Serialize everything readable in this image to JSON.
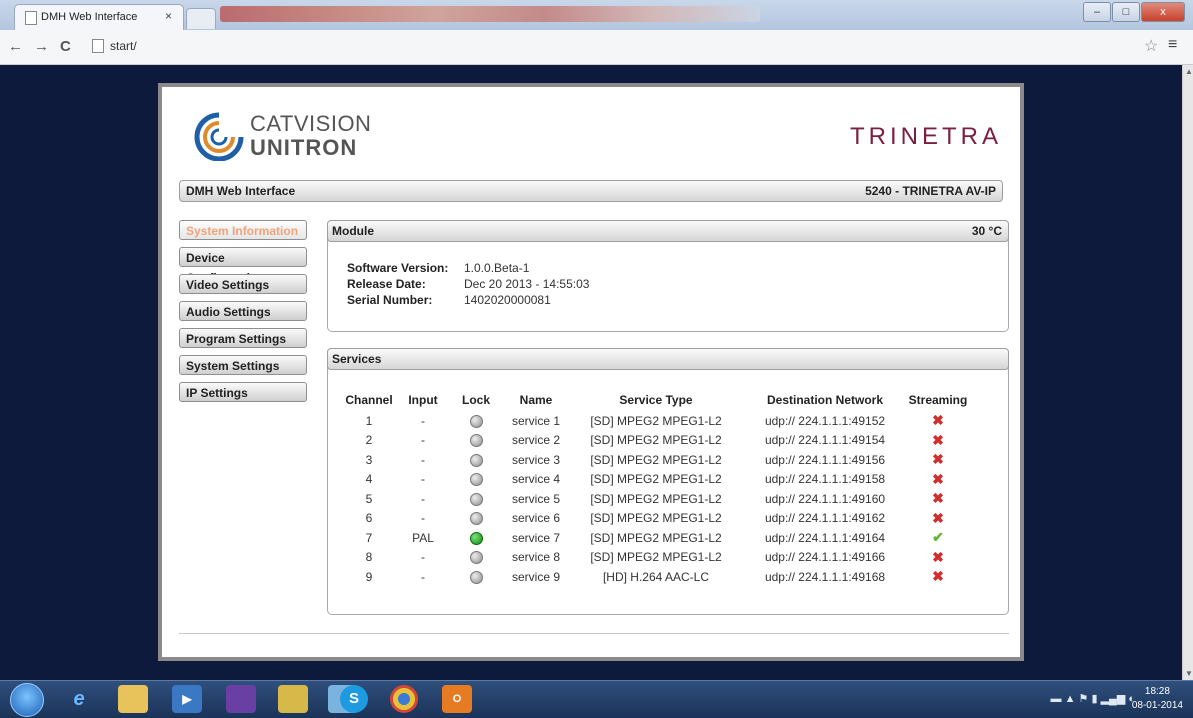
{
  "browser": {
    "tab_title": "DMH Web Interface",
    "tab_close": "×",
    "url": "start/",
    "nav_back": "←",
    "nav_forward": "→",
    "nav_reload": "C",
    "star": "☆",
    "menu": "≡",
    "window_buttons": [
      "–",
      "□",
      "x"
    ]
  },
  "branding": {
    "logo_line1": "CATVISION",
    "logo_line2": "UNITRON",
    "product_logo": "TRINETRA"
  },
  "header": {
    "left": "DMH Web Interface",
    "right": "5240 - TRINETRA AV-IP"
  },
  "sidebar": {
    "items": [
      {
        "label": "System Information",
        "active": true
      },
      {
        "label": "Device Configuration",
        "active": false
      },
      {
        "label": "Video Settings",
        "active": false
      },
      {
        "label": "Audio Settings",
        "active": false
      },
      {
        "label": "Program Settings",
        "active": false
      },
      {
        "label": "System Settings",
        "active": false
      },
      {
        "label": "IP Settings",
        "active": false
      }
    ]
  },
  "module": {
    "title": "Module",
    "temperature": "30 °C",
    "fields": [
      {
        "label": "Software Version:",
        "value": "1.0.0.Beta-1"
      },
      {
        "label": "Release Date:",
        "value": "Dec 20 2013 - 14:55:03"
      },
      {
        "label": "Serial Number:",
        "value": "1402020000081"
      }
    ]
  },
  "services": {
    "title": "Services",
    "columns": [
      "Channel",
      "Input",
      "Lock",
      "Name",
      "Service Type",
      "Destination Network",
      "Streaming"
    ],
    "rows": [
      {
        "channel": "1",
        "input": "-",
        "lock": false,
        "name": "service 1",
        "type": "[SD] MPEG2 MPEG1-L2",
        "dest": "udp:// 224.1.1.1:49152",
        "streaming": false
      },
      {
        "channel": "2",
        "input": "-",
        "lock": false,
        "name": "service 2",
        "type": "[SD] MPEG2 MPEG1-L2",
        "dest": "udp:// 224.1.1.1:49154",
        "streaming": false
      },
      {
        "channel": "3",
        "input": "-",
        "lock": false,
        "name": "service 3",
        "type": "[SD] MPEG2 MPEG1-L2",
        "dest": "udp:// 224.1.1.1:49156",
        "streaming": false
      },
      {
        "channel": "4",
        "input": "-",
        "lock": false,
        "name": "service 4",
        "type": "[SD] MPEG2 MPEG1-L2",
        "dest": "udp:// 224.1.1.1:49158",
        "streaming": false
      },
      {
        "channel": "5",
        "input": "-",
        "lock": false,
        "name": "service 5",
        "type": "[SD] MPEG2 MPEG1-L2",
        "dest": "udp:// 224.1.1.1:49160",
        "streaming": false
      },
      {
        "channel": "6",
        "input": "-",
        "lock": false,
        "name": "service 6",
        "type": "[SD] MPEG2 MPEG1-L2",
        "dest": "udp:// 224.1.1.1:49162",
        "streaming": false
      },
      {
        "channel": "7",
        "input": "PAL",
        "lock": true,
        "name": "service 7",
        "type": "[SD] MPEG2 MPEG1-L2",
        "dest": "udp:// 224.1.1.1:49164",
        "streaming": true
      },
      {
        "channel": "8",
        "input": "-",
        "lock": false,
        "name": "service 8",
        "type": "[SD] MPEG2 MPEG1-L2",
        "dest": "udp:// 224.1.1.1:49166",
        "streaming": false
      },
      {
        "channel": "9",
        "input": "-",
        "lock": false,
        "name": "service 9",
        "type": "[HD] H.264 AAC-LC",
        "dest": "udp:// 224.1.1.1:49168",
        "streaming": false
      }
    ]
  },
  "status_icons": {
    "ok": "✔",
    "fail": "✖"
  },
  "colors": {
    "active_sidebar": "#f0a37a",
    "lock_on": "#0b8a0b",
    "stream_fail": "#d12d2d",
    "stream_ok": "#62b62f",
    "brand_maroon": "#7a1f3d"
  },
  "taskbar": {
    "icons": [
      "start-orb",
      "ie-icon",
      "explorer-icon",
      "media-icon",
      "vs-icon",
      "folder-icon",
      "photos-icon",
      "skype-icon",
      "chrome-icon",
      "outlook-icon"
    ],
    "skype_letter": "S",
    "clock_time": "18:28",
    "clock_date": "08-01-2014"
  }
}
